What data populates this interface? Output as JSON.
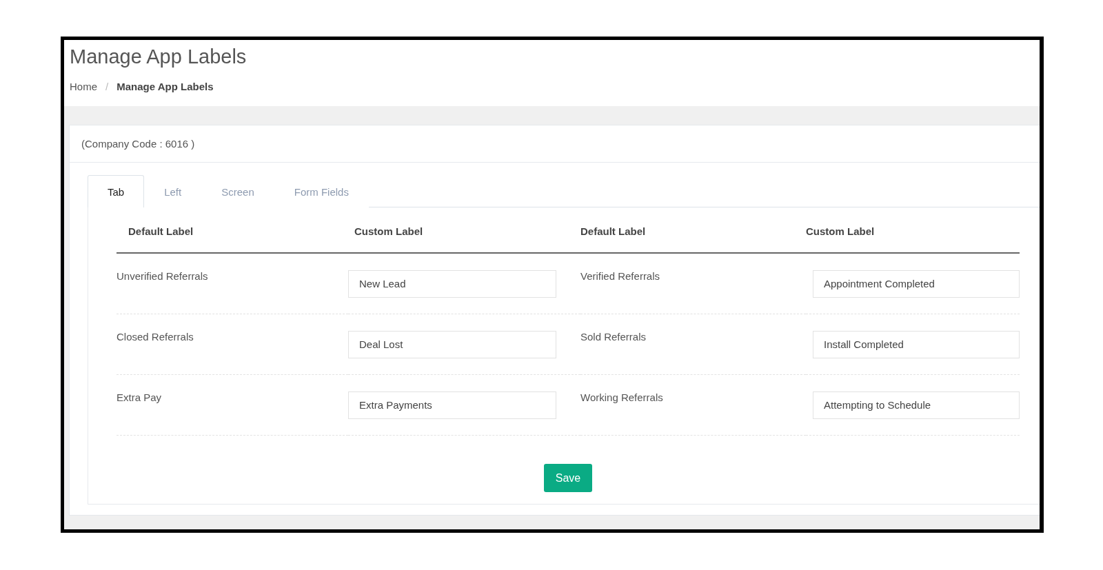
{
  "page": {
    "title": "Manage App Labels"
  },
  "breadcrumb_separator": "/",
  "breadcrumb": [
    {
      "label": "Home",
      "current": false
    },
    {
      "label": "Manage App Labels",
      "current": true
    }
  ],
  "company_code": "(Company Code : 6016 )",
  "tabs": [
    {
      "label": "Tab",
      "selected": true
    },
    {
      "label": "Left",
      "selected": false
    },
    {
      "label": "Screen",
      "selected": false
    },
    {
      "label": "Form Fields",
      "selected": false
    }
  ],
  "table": {
    "columns": [
      "Default Label",
      "Custom Label",
      "Default Label",
      "Custom Label"
    ],
    "rows": [
      {
        "pairs": [
          {
            "default": "Unverified Referrals",
            "custom": "New Lead"
          },
          {
            "default": "Verified Referrals",
            "custom": "Appointment Completed"
          }
        ]
      },
      {
        "pairs": [
          {
            "default": "Closed Referrals",
            "custom": "Deal Lost"
          },
          {
            "default": "Sold Referrals",
            "custom": "Install Completed"
          }
        ]
      },
      {
        "pairs": [
          {
            "default": "Extra Pay",
            "custom": "Extra Payments"
          },
          {
            "default": "Working Referrals",
            "custom": "Attempting to Schedule"
          }
        ]
      }
    ]
  },
  "save_button": "Save"
}
